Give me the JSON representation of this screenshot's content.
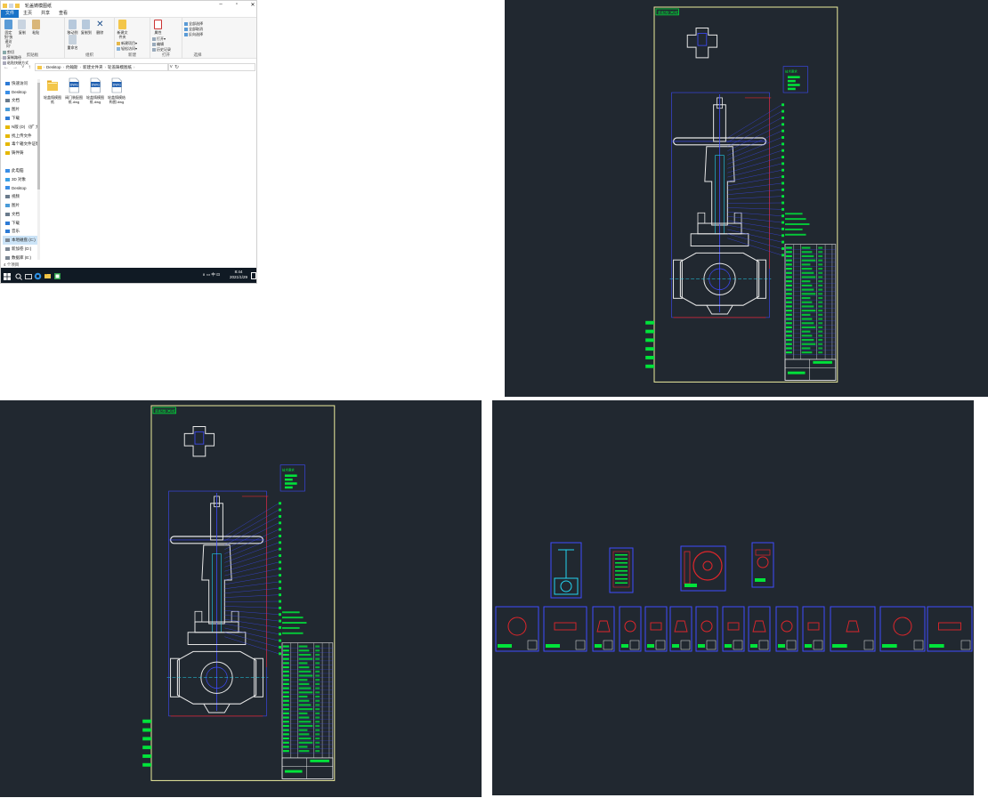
{
  "explorer": {
    "title": "轮盖铸模图纸",
    "ribbon_tabs": [
      "文件",
      "主页",
      "共享",
      "查看"
    ],
    "ribbon": {
      "clipboard": {
        "name": "剪贴板",
        "buttons": [
          "固定到\"快速访问\"",
          "复制",
          "粘贴"
        ],
        "small": [
          "剪切",
          "复制路径",
          "粘贴快捷方式"
        ]
      },
      "organize": {
        "name": "组织",
        "buttons": [
          "移动到",
          "复制到",
          "删除",
          "重命名"
        ]
      },
      "new": {
        "name": "新建",
        "buttons": [
          "新建文件夹"
        ],
        "small": [
          "新建项目▾",
          "轻松访问▾"
        ]
      },
      "open": {
        "name": "打开",
        "buttons": [
          "属性"
        ],
        "small": [
          "打开▾",
          "编辑",
          "历史记录"
        ]
      },
      "select": {
        "name": "选择",
        "small": [
          "全部选择",
          "全部取消",
          "反向选择"
        ]
      }
    },
    "address": {
      "crumbs": [
        "Desktop",
        "约翰斯",
        "新建文件夹",
        "轮盖铸模图纸"
      ]
    },
    "nav": [
      {
        "label": "快速访问",
        "color": "#2d7bd6"
      },
      {
        "label": "Desktop",
        "color": "#3a8ee6"
      },
      {
        "label": "文档",
        "color": "#6a7b8c"
      },
      {
        "label": "图片",
        "color": "#4a9bd8"
      },
      {
        "label": "下载",
        "color": "#2d7bd6"
      },
      {
        "label": "N版 (D) 《扩 大》",
        "color": "#e6b800"
      },
      {
        "label": "找上传文件",
        "color": "#e6b800"
      },
      {
        "label": "毒个箱文件证明",
        "color": "#e6b800"
      },
      {
        "label": "铸件铸",
        "color": "#e6b800"
      },
      {
        "label": "",
        "color": ""
      },
      {
        "label": "此电脑",
        "color": "#3a8ee6"
      },
      {
        "label": "3D 对象",
        "color": "#3aa0e6"
      },
      {
        "label": "Desktop",
        "color": "#3a8ee6"
      },
      {
        "label": "视频",
        "color": "#6a7b8c"
      },
      {
        "label": "图片",
        "color": "#4a9bd8"
      },
      {
        "label": "文档",
        "color": "#6a7b8c"
      },
      {
        "label": "下载",
        "color": "#2d7bd6"
      },
      {
        "label": "音乐",
        "color": "#2d7bd6"
      },
      {
        "label": "本地磁盘 (C:)",
        "color": "#7c8794",
        "selected": true
      },
      {
        "label": "新加卷 (D:)",
        "color": "#7c8794"
      },
      {
        "label": "数据库 (E:)",
        "color": "#7c8794"
      }
    ],
    "files": [
      {
        "name": "轮盖铸模图纸",
        "kind": "folder"
      },
      {
        "name": "阀门装配图纸.dwg",
        "kind": "dwg"
      },
      {
        "name": "轮盖铸模图纸.dwg",
        "kind": "dwg"
      },
      {
        "name": "轮盖铸模结构图.dwg",
        "kind": "dwg"
      }
    ],
    "status": "4 个项目",
    "taskbar": {
      "time": "8:44",
      "date": "2021/1/29",
      "tray": "∧ ▭ 中 ⊡"
    }
  },
  "cad": {
    "drawing_header": "装配图(闸阀)",
    "tech_title": "技术要求",
    "colors": {
      "background": "#212830",
      "frame": "#f0f0a0",
      "outline": "#3e4bff",
      "green": "#00e33a",
      "red": "#e0262b",
      "cyan": "#24d4f0",
      "white": "#e8e8e8"
    }
  }
}
